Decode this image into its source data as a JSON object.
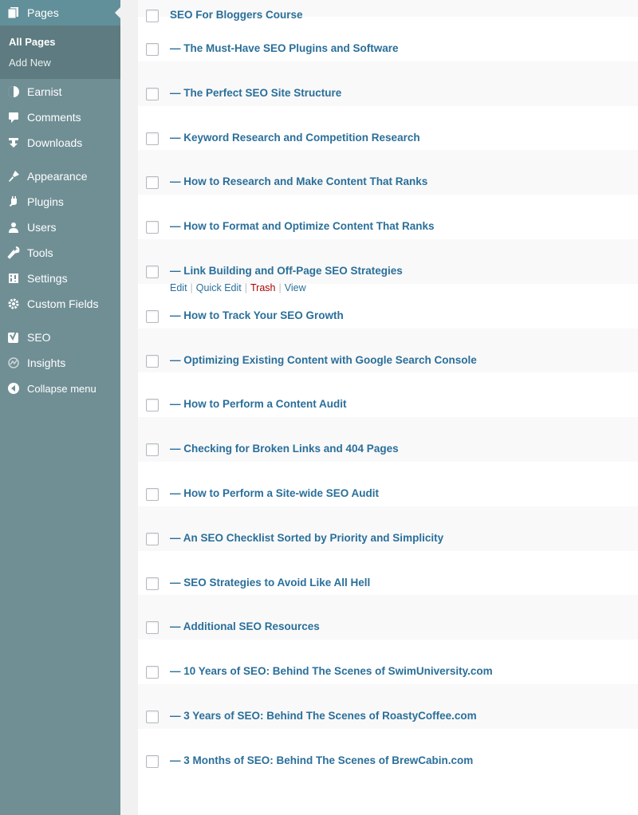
{
  "sidebar": {
    "current": {
      "label": "Pages",
      "icon": "pages-icon"
    },
    "submenu": [
      {
        "label": "All Pages",
        "active": true
      },
      {
        "label": "Add New",
        "active": false
      }
    ],
    "items": [
      {
        "label": "Earnist",
        "icon": "earnist-icon"
      },
      {
        "label": "Comments",
        "icon": "comments-icon"
      },
      {
        "label": "Downloads",
        "icon": "downloads-icon"
      },
      {
        "label": "Appearance",
        "icon": "appearance-icon"
      },
      {
        "label": "Plugins",
        "icon": "plugins-icon"
      },
      {
        "label": "Users",
        "icon": "users-icon"
      },
      {
        "label": "Tools",
        "icon": "tools-icon"
      },
      {
        "label": "Settings",
        "icon": "settings-icon"
      },
      {
        "label": "Custom Fields",
        "icon": "custom-fields-icon"
      },
      {
        "label": "SEO",
        "icon": "seo-icon"
      },
      {
        "label": "Insights",
        "icon": "insights-icon"
      },
      {
        "label": "Collapse menu",
        "icon": "collapse-icon"
      }
    ]
  },
  "pages": [
    {
      "title": "SEO For Bloggers Course"
    },
    {
      "title": "— The Must-Have SEO Plugins and Software"
    },
    {
      "title": "— The Perfect SEO Site Structure"
    },
    {
      "title": "— Keyword Research and Competition Research"
    },
    {
      "title": "— How to Research and Make Content That Ranks"
    },
    {
      "title": "— How to Format and Optimize Content That Ranks"
    },
    {
      "title": "— Link Building and Off-Page SEO Strategies"
    },
    {
      "title": "— How to Track Your SEO Growth"
    },
    {
      "title": "— Optimizing Existing Content with Google Search Console"
    },
    {
      "title": "— How to Perform a Content Audit"
    },
    {
      "title": "— Checking for Broken Links and 404 Pages"
    },
    {
      "title": "— How to Perform a Site-wide SEO Audit"
    },
    {
      "title": "— An SEO Checklist Sorted by Priority and Simplicity"
    },
    {
      "title": "— SEO Strategies to Avoid Like All Hell"
    },
    {
      "title": "— Additional SEO Resources"
    },
    {
      "title": "— 10 Years of SEO: Behind The Scenes of SwimUniversity.com"
    },
    {
      "title": "— 3 Years of SEO: Behind The Scenes of RoastyCoffee.com"
    },
    {
      "title": "— 3 Months of SEO: Behind The Scenes of BrewCabin.com"
    }
  ],
  "row_actions": {
    "edit": "Edit",
    "quick_edit": "Quick Edit",
    "trash": "Trash",
    "view": "View"
  },
  "colors": {
    "sidebar": "#708f95",
    "link": "#2a6f9a",
    "trash": "#aa0000"
  }
}
